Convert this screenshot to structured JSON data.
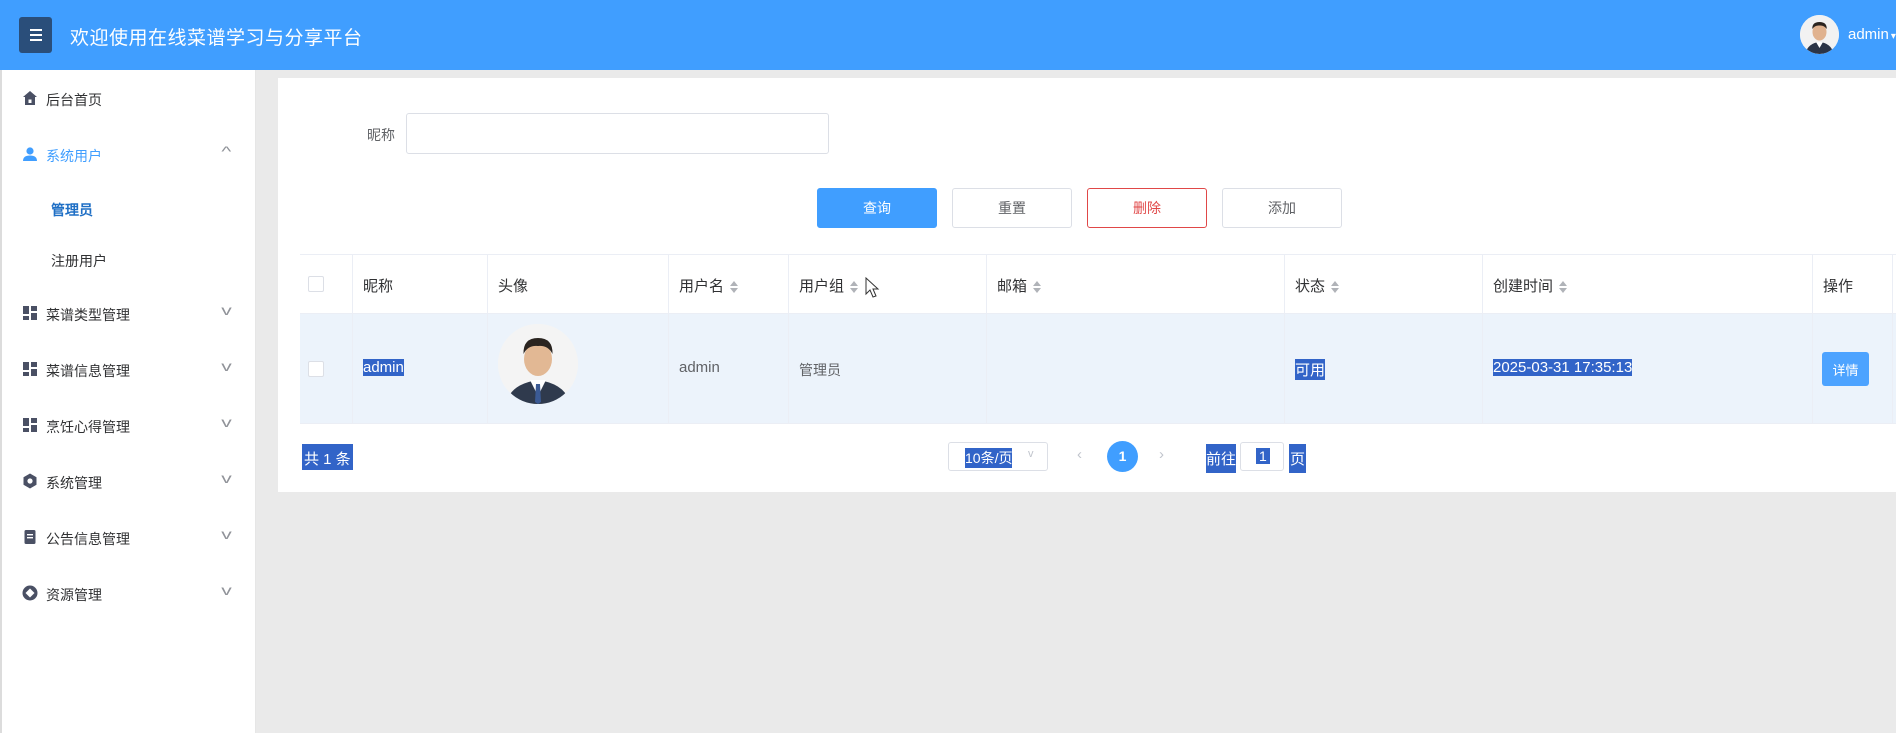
{
  "header": {
    "title": "欢迎使用在线菜谱学习与分享平台",
    "username": "admin"
  },
  "sidebar": {
    "items": [
      {
        "label": "后台首页",
        "icon": "home-icon"
      },
      {
        "label": "系统用户",
        "icon": "user-icon",
        "expanded": true,
        "children": [
          {
            "label": "管理员",
            "active": true
          },
          {
            "label": "注册用户"
          }
        ]
      },
      {
        "label": "菜谱类型管理",
        "icon": "grid-icon"
      },
      {
        "label": "菜谱信息管理",
        "icon": "grid-icon"
      },
      {
        "label": "烹饪心得管理",
        "icon": "grid-icon"
      },
      {
        "label": "系统管理",
        "icon": "gear-icon"
      },
      {
        "label": "公告信息管理",
        "icon": "document-icon"
      },
      {
        "label": "资源管理",
        "icon": "plus-circle-icon"
      }
    ]
  },
  "search": {
    "nickname_label": "昵称",
    "nickname_value": ""
  },
  "toolbar": {
    "query": "查询",
    "reset": "重置",
    "delete": "删除",
    "add": "添加"
  },
  "table": {
    "columns": [
      "昵称",
      "头像",
      "用户名",
      "用户组",
      "邮箱",
      "状态",
      "创建时间",
      "操作"
    ],
    "rows": [
      {
        "nickname": "admin",
        "username": "admin",
        "group": "管理员",
        "email": "",
        "status": "可用",
        "created": "2025-03-31 17:35:13",
        "action": "详情"
      }
    ]
  },
  "pagination": {
    "total": "共 1 条",
    "page_size": "10条/页",
    "current": "1",
    "goto_label": "前往",
    "goto_value": "1",
    "page_unit": "页"
  },
  "colors": {
    "primary": "#409eff",
    "danger": "#e04848",
    "selection": "#3264c8"
  }
}
